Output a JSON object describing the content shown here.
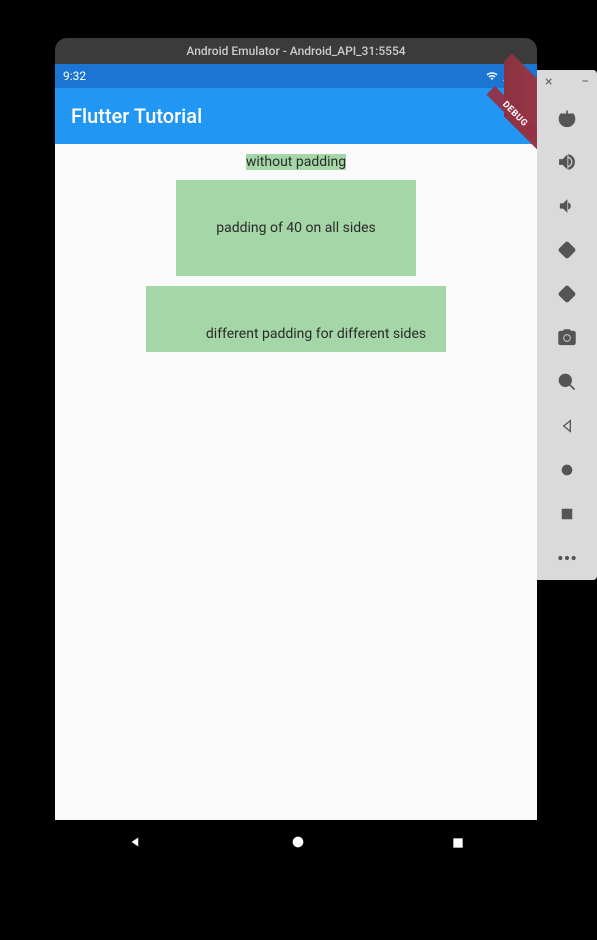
{
  "emulator": {
    "title": "Android Emulator - Android_API_31:5554"
  },
  "status_bar": {
    "time": "9:32"
  },
  "app_bar": {
    "title": "Flutter Tutorial",
    "debug_label": "DEBUG"
  },
  "content": {
    "box1": "without padding",
    "box2": "padding of 40 on all sides",
    "box3": "different padding for different sides"
  },
  "sidebar": {
    "close": "×",
    "minimize": "−"
  }
}
